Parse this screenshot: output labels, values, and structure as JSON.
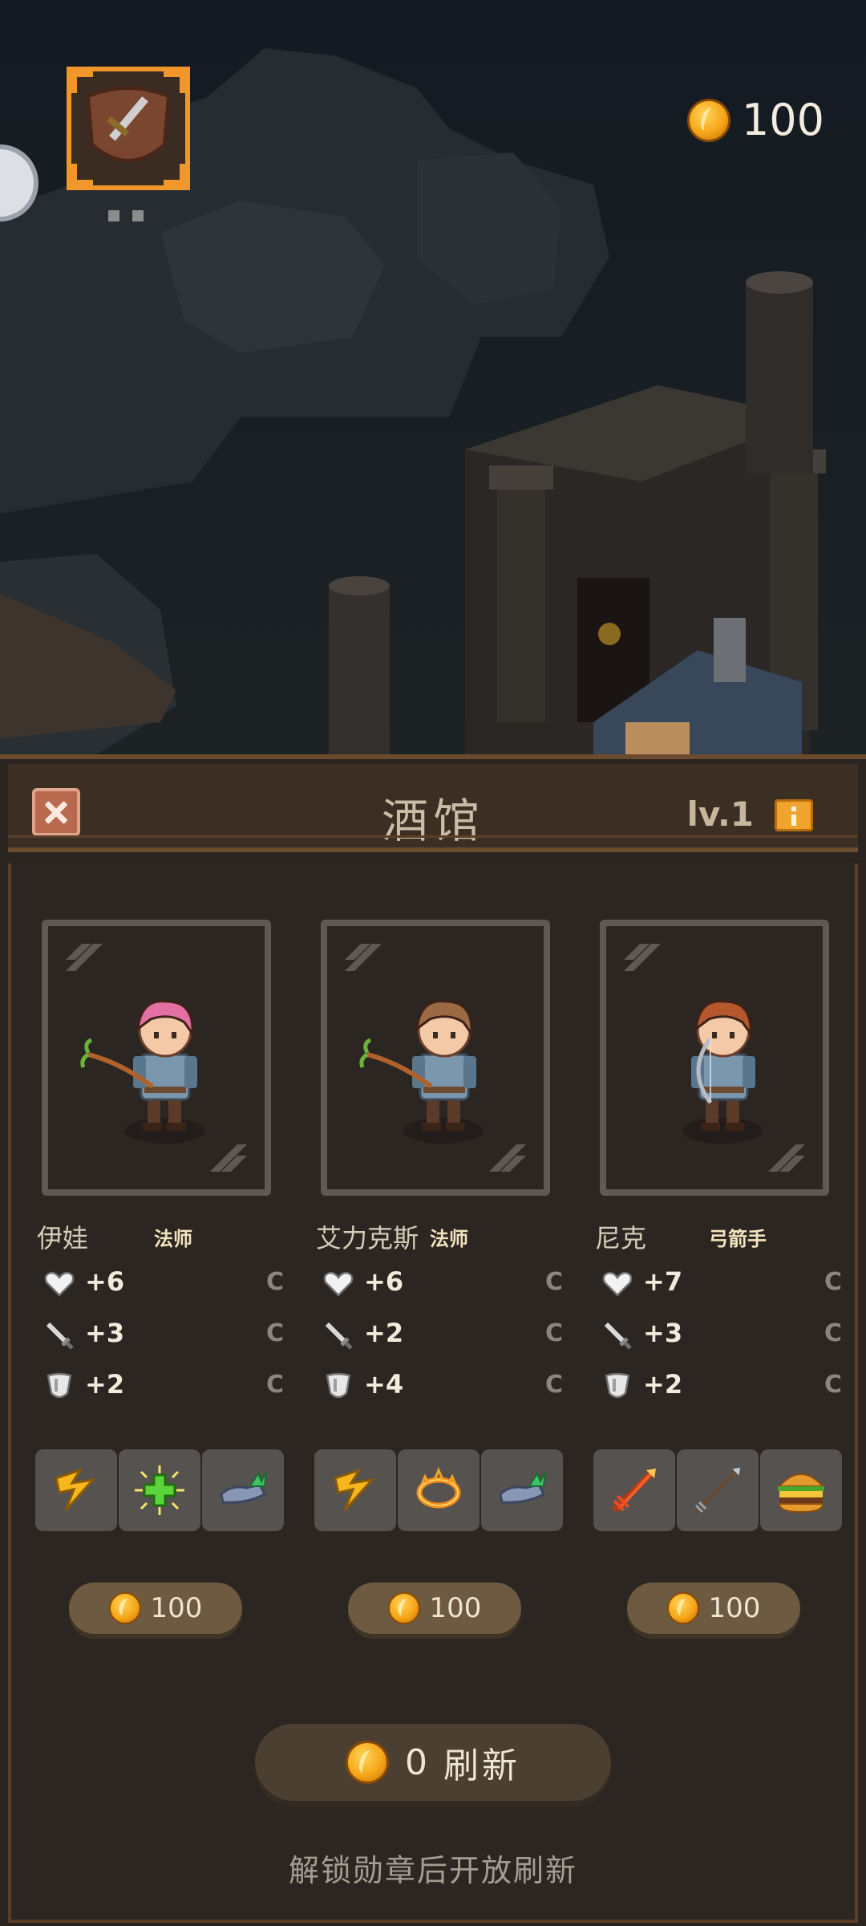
{
  "hud": {
    "gold": "100"
  },
  "panel": {
    "title": "酒馆",
    "level": "lv.1"
  },
  "heroes": [
    {
      "name": "伊娃",
      "class": "法师",
      "stats": [
        {
          "icon": "heart-icon",
          "value": "+6",
          "grade": "C"
        },
        {
          "icon": "sword-icon",
          "value": "+3",
          "grade": "C"
        },
        {
          "icon": "shield-icon",
          "value": "+2",
          "grade": "C"
        }
      ],
      "skills": [
        "lightning-bolt-icon",
        "green-cross-icon",
        "winged-boots-icon"
      ],
      "price": "100",
      "hair": "#e46fa3",
      "weapon": "staff"
    },
    {
      "name": "艾力克斯",
      "class": "法师",
      "stats": [
        {
          "icon": "heart-icon",
          "value": "+6",
          "grade": "C"
        },
        {
          "icon": "sword-icon",
          "value": "+2",
          "grade": "C"
        },
        {
          "icon": "shield-icon",
          "value": "+4",
          "grade": "C"
        }
      ],
      "skills": [
        "lightning-bolt-icon",
        "fire-ring-icon",
        "winged-boots-icon"
      ],
      "price": "100",
      "hair": "#9b6a45",
      "weapon": "staff"
    },
    {
      "name": "尼克",
      "class": "弓箭手",
      "stats": [
        {
          "icon": "heart-icon",
          "value": "+7",
          "grade": "C"
        },
        {
          "icon": "sword-icon",
          "value": "+3",
          "grade": "C"
        },
        {
          "icon": "shield-icon",
          "value": "+2",
          "grade": "C"
        }
      ],
      "skills": [
        "fire-arrow-icon",
        "arrow-icon",
        "burger-icon"
      ],
      "price": "100",
      "hair": "#b5582e",
      "weapon": "bow"
    }
  ],
  "refresh": {
    "cost": "0",
    "label": "刷新"
  },
  "tip": "解锁勋章后开放刷新"
}
